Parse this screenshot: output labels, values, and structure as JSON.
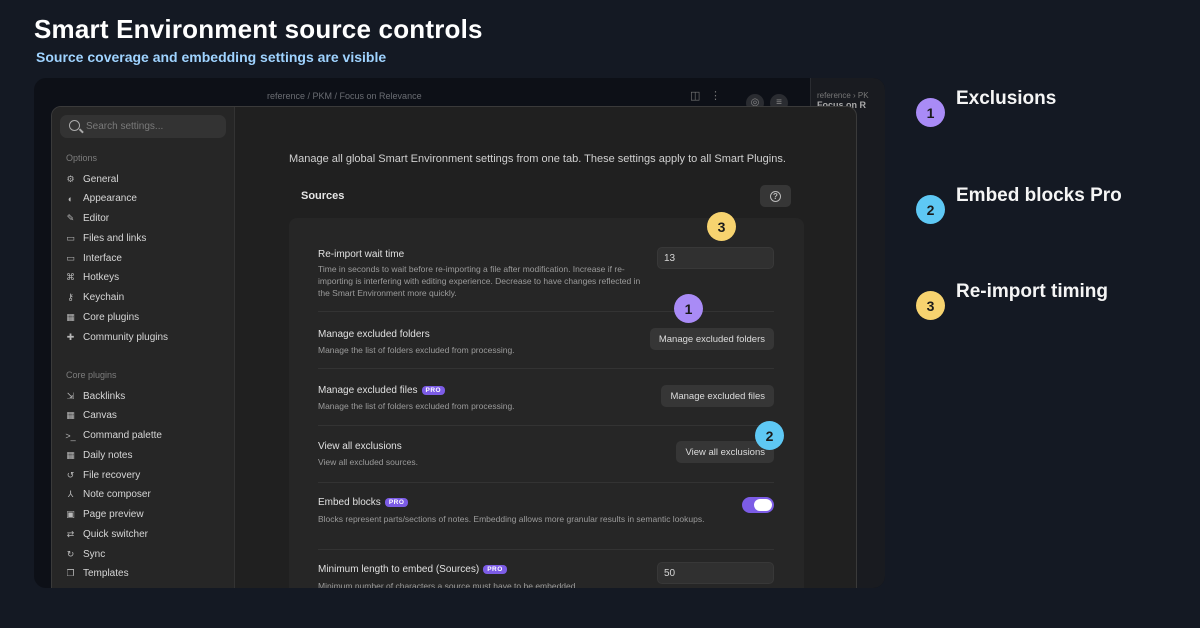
{
  "header": {
    "title": "Smart Environment source controls",
    "subtitle": "Source coverage and embedding settings are visible"
  },
  "background": {
    "breadcrumb": "reference / PKM / Focus on Relevance",
    "right_crumb": "reference › PK",
    "right_title": "Focus on R"
  },
  "sidebar": {
    "search_placeholder": "Search settings...",
    "options_heading": "Options",
    "options": [
      {
        "label": "General",
        "icon": "gear-icon"
      },
      {
        "label": "Appearance",
        "icon": "palette-icon"
      },
      {
        "label": "Editor",
        "icon": "pencil-icon"
      },
      {
        "label": "Files and links",
        "icon": "folder-icon"
      },
      {
        "label": "Interface",
        "icon": "monitor-icon"
      },
      {
        "label": "Hotkeys",
        "icon": "command-icon"
      },
      {
        "label": "Keychain",
        "icon": "key-icon"
      },
      {
        "label": "Core plugins",
        "icon": "calendar-icon"
      },
      {
        "label": "Community plugins",
        "icon": "puzzle-icon"
      }
    ],
    "core_heading": "Core plugins",
    "core": [
      {
        "label": "Backlinks",
        "icon": "link-icon"
      },
      {
        "label": "Canvas",
        "icon": "grid-icon"
      },
      {
        "label": "Command palette",
        "icon": "terminal-icon"
      },
      {
        "label": "Daily notes",
        "icon": "calendar-icon"
      },
      {
        "label": "File recovery",
        "icon": "history-icon"
      },
      {
        "label": "Note composer",
        "icon": "merge-icon"
      },
      {
        "label": "Page preview",
        "icon": "preview-icon"
      },
      {
        "label": "Quick switcher",
        "icon": "switch-icon"
      },
      {
        "label": "Sync",
        "icon": "sync-icon"
      },
      {
        "label": "Templates",
        "icon": "template-icon"
      }
    ]
  },
  "main": {
    "intro": "Manage all global Smart Environment settings from one tab. These settings apply to all Smart Plugins.",
    "section_title": "Sources",
    "settings": {
      "reimport": {
        "name": "Re-import wait time",
        "desc": "Time in seconds to wait before re-importing a file after modification. Increase if re-importing is interfering with editing experience. Decrease to have changes reflected in the Smart Environment more quickly.",
        "value": "13"
      },
      "folders": {
        "name": "Manage excluded folders",
        "desc": "Manage the list of folders excluded from processing.",
        "button": "Manage excluded folders"
      },
      "files": {
        "name": "Manage excluded files",
        "pro": "PRO",
        "desc": "Manage the list of folders excluded from processing.",
        "button": "Manage excluded files"
      },
      "view": {
        "name": "View all exclusions",
        "desc": "View all excluded sources.",
        "button": "View all exclusions"
      },
      "embed": {
        "name": "Embed blocks",
        "pro": "PRO",
        "desc": "Blocks represent parts/sections of notes. Embedding allows more granular results in semantic lookups.",
        "enabled": true
      },
      "minlen": {
        "name": "Minimum length to embed (Sources)",
        "pro": "PRO",
        "desc": "Minimum number of characters a source must have to be embedded.",
        "value": "50"
      }
    }
  },
  "callouts": [
    {
      "number": "1",
      "label": "Exclusions",
      "color": "#a98bf6"
    },
    {
      "number": "2",
      "label": "Embed blocks Pro",
      "color": "#5ec8f4"
    },
    {
      "number": "3",
      "label": "Re-import timing",
      "color": "#f7d36f"
    }
  ],
  "colors": {
    "accent": "#7c5ce6",
    "background": "#141923"
  }
}
